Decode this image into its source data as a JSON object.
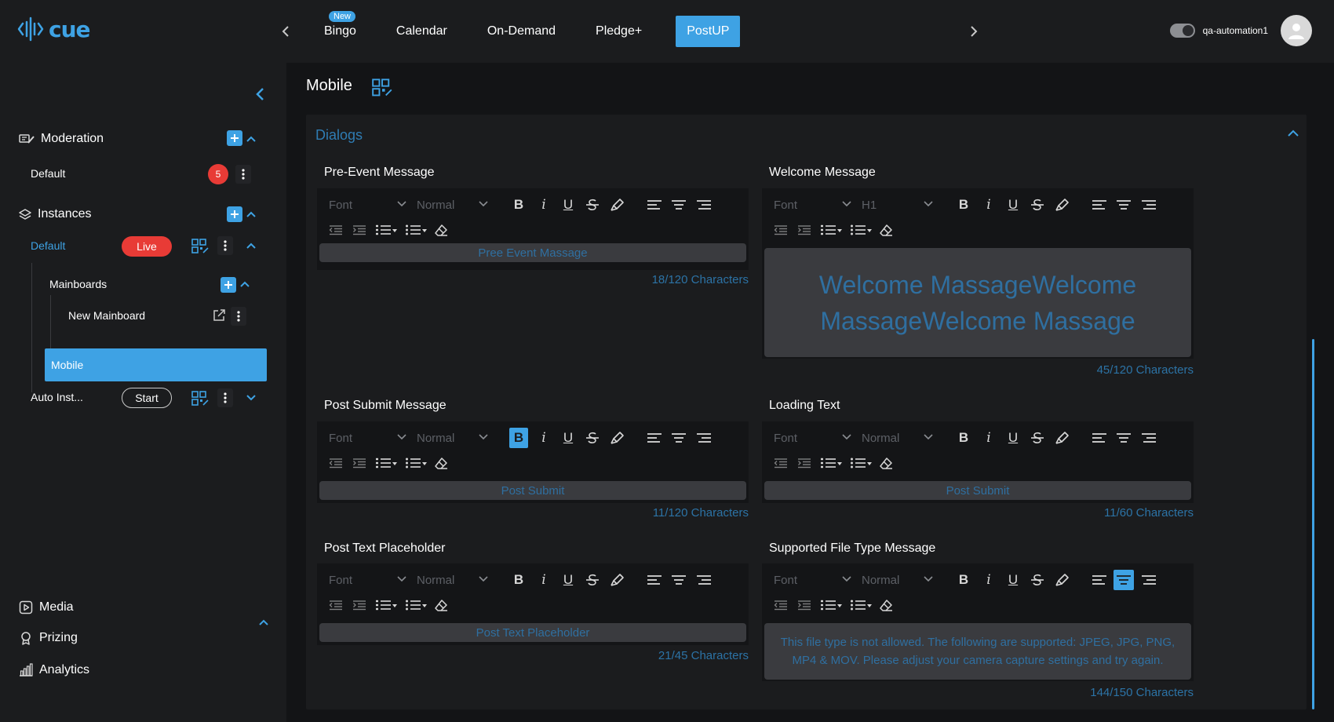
{
  "app": {
    "logo_text": "cue"
  },
  "nav": {
    "tabs": [
      {
        "label": "Bingo",
        "badge": "New"
      },
      {
        "label": "Calendar"
      },
      {
        "label": "On-Demand"
      },
      {
        "label": "Pledge+"
      },
      {
        "label": "PostUP",
        "active": true
      }
    ]
  },
  "user": {
    "name": "qa-automation1"
  },
  "sidebar": {
    "moderation": {
      "label": "Moderation",
      "default_label": "Default",
      "count": "5"
    },
    "instances": {
      "label": "Instances",
      "default_label": "Default",
      "live_label": "Live",
      "mainboards_label": "Mainboards",
      "new_mainboard_label": "New Mainboard",
      "mobile_label": "Mobile",
      "auto_inst_label": "Auto Inst...",
      "start_label": "Start"
    },
    "bottom": {
      "media_label": "Media",
      "prizing_label": "Prizing",
      "analytics_label": "Analytics"
    }
  },
  "page": {
    "title": "Mobile"
  },
  "panel": {
    "title": "Dialogs"
  },
  "editors": {
    "pre_event": {
      "label": "Pre-Event Message",
      "font": "Font",
      "size": "Normal",
      "text": "Pree Event Massage",
      "count": "18/120 Characters"
    },
    "welcome": {
      "label": "Welcome Message",
      "font": "Font",
      "size": "H1",
      "text": "Welcome MassageWelcome MassageWelcome Massage",
      "count": "45/120 Characters"
    },
    "post_submit": {
      "label": "Post Submit Message",
      "font": "Font",
      "size": "Normal",
      "text": "Post Submit",
      "count": "11/120 Characters"
    },
    "loading": {
      "label": "Loading Text",
      "font": "Font",
      "size": "Normal",
      "text": "Post Submit",
      "count": "11/60 Characters"
    },
    "placeholder": {
      "label": "Post Text Placeholder",
      "font": "Font",
      "size": "Normal",
      "text": "Post Text Placeholder",
      "count": "21/45 Characters"
    },
    "file_type": {
      "label": "Supported File Type Message",
      "font": "Font",
      "size": "Normal",
      "text": "This file type is not allowed. The following are supported: JPEG, JPG, PNG, MP4 & MOV. Please adjust your camera capture settings and try again.",
      "count": "144/150 Characters"
    }
  },
  "toolbar_icons": [
    "bold-icon",
    "italic-icon",
    "underline-icon",
    "strikethrough-icon",
    "highlighter-icon",
    "align-left-icon",
    "align-center-icon",
    "align-right-icon",
    "outdent-icon",
    "indent-icon",
    "ordered-list-icon",
    "bullet-list-icon",
    "clear-format-icon"
  ],
  "colors": {
    "accent": "#3ea2e4",
    "danger": "#e83b36",
    "background": "#1b1c1e",
    "main_background": "#131416",
    "muted_text": "#2c73a6"
  }
}
